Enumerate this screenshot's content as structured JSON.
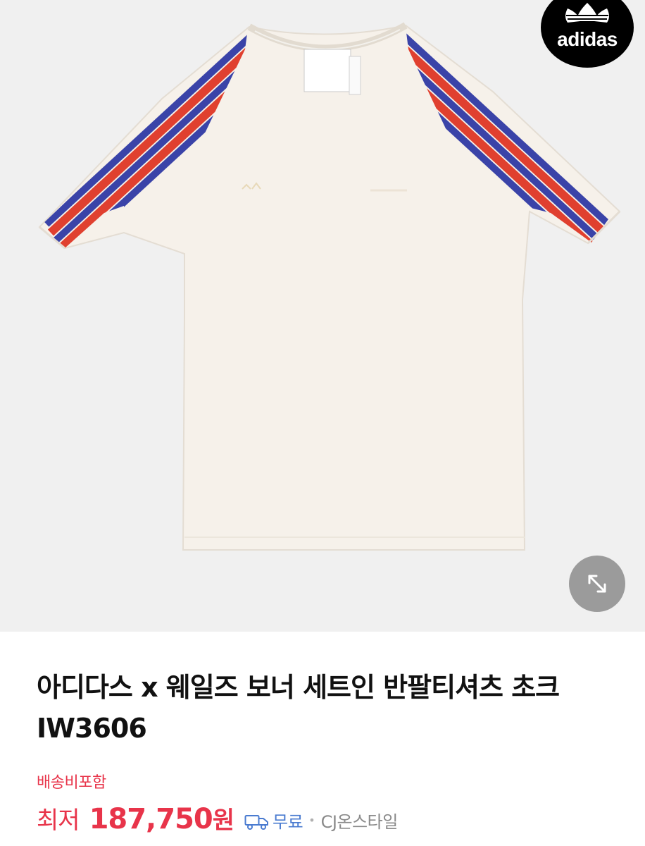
{
  "product": {
    "title": "아디다스 x 웨일즈 보너 세트인 반팔티셔츠 초크 IW3606",
    "brand_logo_text": "adidas",
    "image_icon": "tshirt-image",
    "expand_icon": "expand-arrows-icon"
  },
  "pricing": {
    "shipping_note": "배송비포함",
    "price_prefix": "최저",
    "price_amount": "187,750",
    "price_unit": "원",
    "delivery_icon": "truck-icon",
    "delivery_label": "무료",
    "separator": "•",
    "seller": "CJ온스타일"
  },
  "colors": {
    "accent_red": "#e8344a",
    "free_blue": "#4a7bd0",
    "stripe_red": "#e0402f",
    "stripe_blue": "#3a43a8",
    "shirt": "#f6f1ea"
  }
}
